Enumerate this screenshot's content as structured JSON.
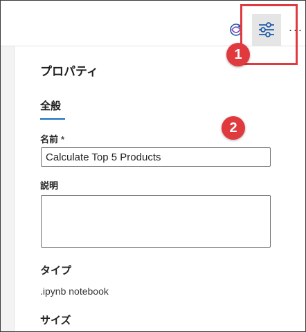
{
  "toolbar": {
    "copilot_icon": "sparkle-copilot-icon",
    "properties_icon": "sliders-settings-icon",
    "more_label": "···"
  },
  "annotations": {
    "badge_1": "1",
    "badge_2": "2",
    "color": "#e0393e"
  },
  "properties": {
    "title": "プロパティ",
    "tab_general": "全般",
    "name_label": "名前",
    "required_marker": "*",
    "name_value": "Calculate Top 5 Products",
    "description_label": "説明",
    "description_value": "",
    "type_label": "タイプ",
    "type_value": ".ipynb notebook",
    "size_label": "サイズ"
  },
  "colors": {
    "accent": "#0f6cbd",
    "selected_button_bg": "#e5e5e5",
    "highlight": "#e0393e"
  }
}
